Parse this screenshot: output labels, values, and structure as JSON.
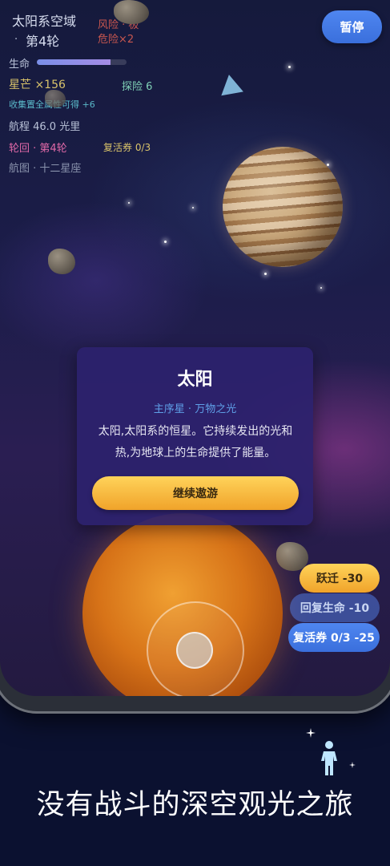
{
  "hud": {
    "region": "太阳系空域",
    "round_prefix": "·",
    "round": "第4轮",
    "risk": "风险 · 极",
    "danger": "危险×2",
    "hp_label": "生命",
    "hp_fraction": 0.82,
    "stardust": "星芒 ×156",
    "explore": "探险 6",
    "collect_note": "收集置全属性可得 +6",
    "voyage": "航程 46.0 光里",
    "cycle_label": "轮回 · 第4轮",
    "revive": "复活券 0/3",
    "route": "航图 · 十二星座"
  },
  "pause_button": "暂停",
  "info_card": {
    "title": "太阳",
    "tag": "主序星 · 万物之光",
    "description": "太阳,太阳系的恒星。它持续发出的光和热,为地球上的生命提供了能量。",
    "continue_button": "继续遨游"
  },
  "skills": {
    "warp": "跃迁 -30",
    "heal": "回复生命 -10",
    "revive": "复活券 0/3 -25"
  },
  "caption": "没有战斗的深空观光之旅",
  "colors": {
    "accent_blue": "#3a6fdc",
    "accent_gold": "#f0a32a",
    "card_bg": "#2c226e"
  },
  "icons": [
    "astronaut-icon",
    "sparkle-icon"
  ]
}
